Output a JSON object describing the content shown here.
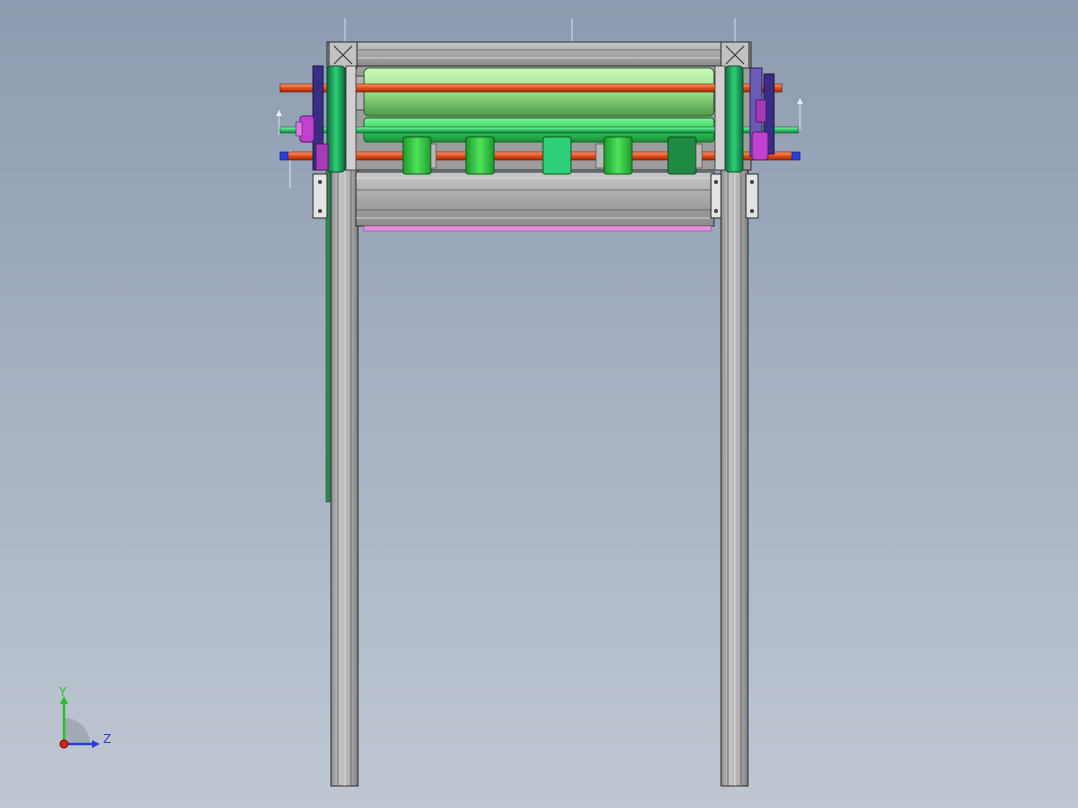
{
  "viewport": {
    "background_top": "#8d9bb0",
    "background_bottom": "#bfc7d2"
  },
  "model": {
    "frame_color": "#a9a9a9",
    "frame_edge_color": "#2b2b2b",
    "main_roller_color": "#9fe88f",
    "belt_color": "#2ed35a",
    "shaft_red_color": "#e2501f",
    "shaft_green_color": "#2fc96a",
    "shaft_blue_color": "#2b3fd8",
    "motor_color": "#c040d0",
    "bracket_color": "#3a2d86",
    "post_color": "#1ea05a",
    "pink_strip_color": "#e890e0"
  },
  "triad": {
    "y_label": "Y",
    "z_label": "Z",
    "y_color": "#2bc02b",
    "z_color": "#2d3fd8",
    "x_color": "#d82020"
  }
}
